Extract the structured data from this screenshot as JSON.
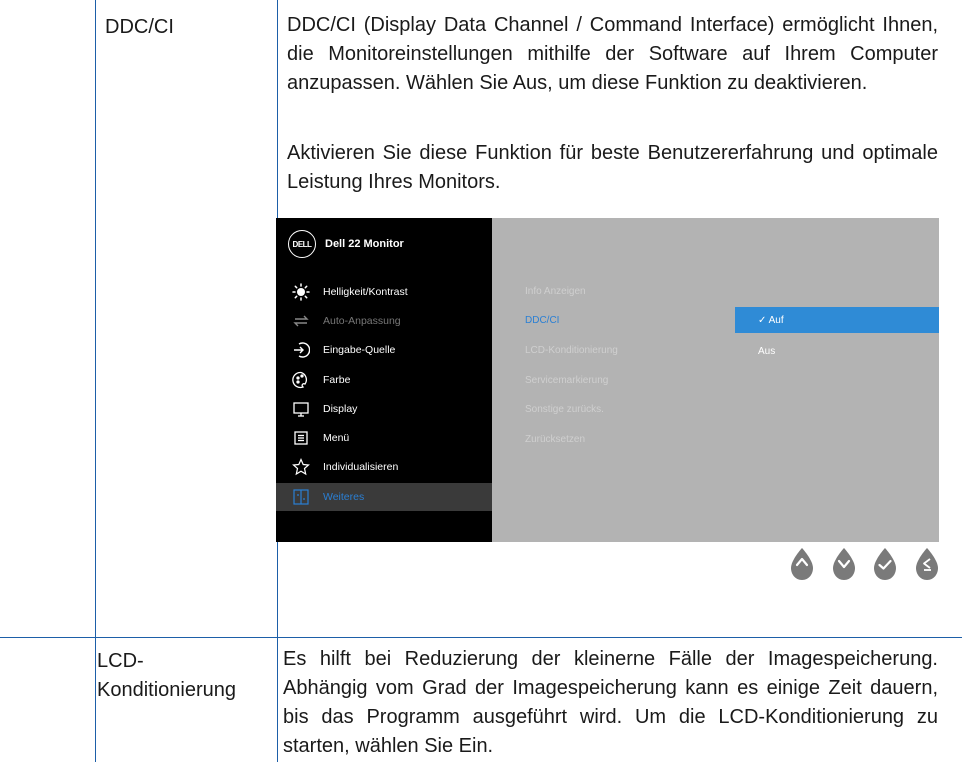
{
  "rows": [
    {
      "label": "DDC/CI",
      "paragraphs": [
        "DDC/CI (Display Data Channel / Command Interface) ermöglicht Ihnen, die Monitoreinstellungen mithilfe der Software auf Ihrem Computer anzupassen. Wählen Sie Aus, um diese Funktion zu deaktivieren.",
        "Aktivieren Sie diese Funktion für beste Benutzererfahrung und optimale Leistung Ihres Monitors."
      ]
    },
    {
      "label_line1": "LCD-",
      "label_line2": "Konditionierung",
      "paragraph": "Es hilft bei Reduzierung der kleinerne Fälle der Imagespeicherung. Abhängig vom Grad der Imagespeicherung kann es einige Zeit dauern, bis das Programm ausgeführt wird. Um die LCD-Konditionierung zu starten, wählen Sie Ein."
    }
  ],
  "osd": {
    "logo": "DELL",
    "title": "Dell 22 Monitor",
    "menu": [
      {
        "label": "Helligkeit/Kontrast",
        "icon": "brightness-icon"
      },
      {
        "label": "Auto-Anpassung",
        "icon": "auto-adjust-icon",
        "dim": true
      },
      {
        "label": "Eingabe-Quelle",
        "icon": "input-source-icon"
      },
      {
        "label": "Farbe",
        "icon": "color-palette-icon"
      },
      {
        "label": "Display",
        "icon": "display-icon"
      },
      {
        "label": "Menü",
        "icon": "menu-icon"
      },
      {
        "label": "Individualisieren",
        "icon": "star-icon"
      },
      {
        "label": "Weiteres",
        "icon": "others-icon",
        "selected": true
      }
    ],
    "submenu": [
      {
        "label": "Info Anzeigen"
      },
      {
        "label": "DDC/CI",
        "active": true
      },
      {
        "label": "LCD-Konditionierung"
      },
      {
        "label": "Servicemarkierung"
      },
      {
        "label": "Sonstige zurücks."
      },
      {
        "label": "Zurücksetzen"
      }
    ],
    "options": [
      {
        "label": "✓ Auf",
        "selected": true
      },
      {
        "label": "Aus",
        "selected": false
      }
    ],
    "accent_color": "#2f8bd6",
    "nav_buttons": [
      "up-icon",
      "down-icon",
      "check-icon",
      "back-icon"
    ]
  }
}
